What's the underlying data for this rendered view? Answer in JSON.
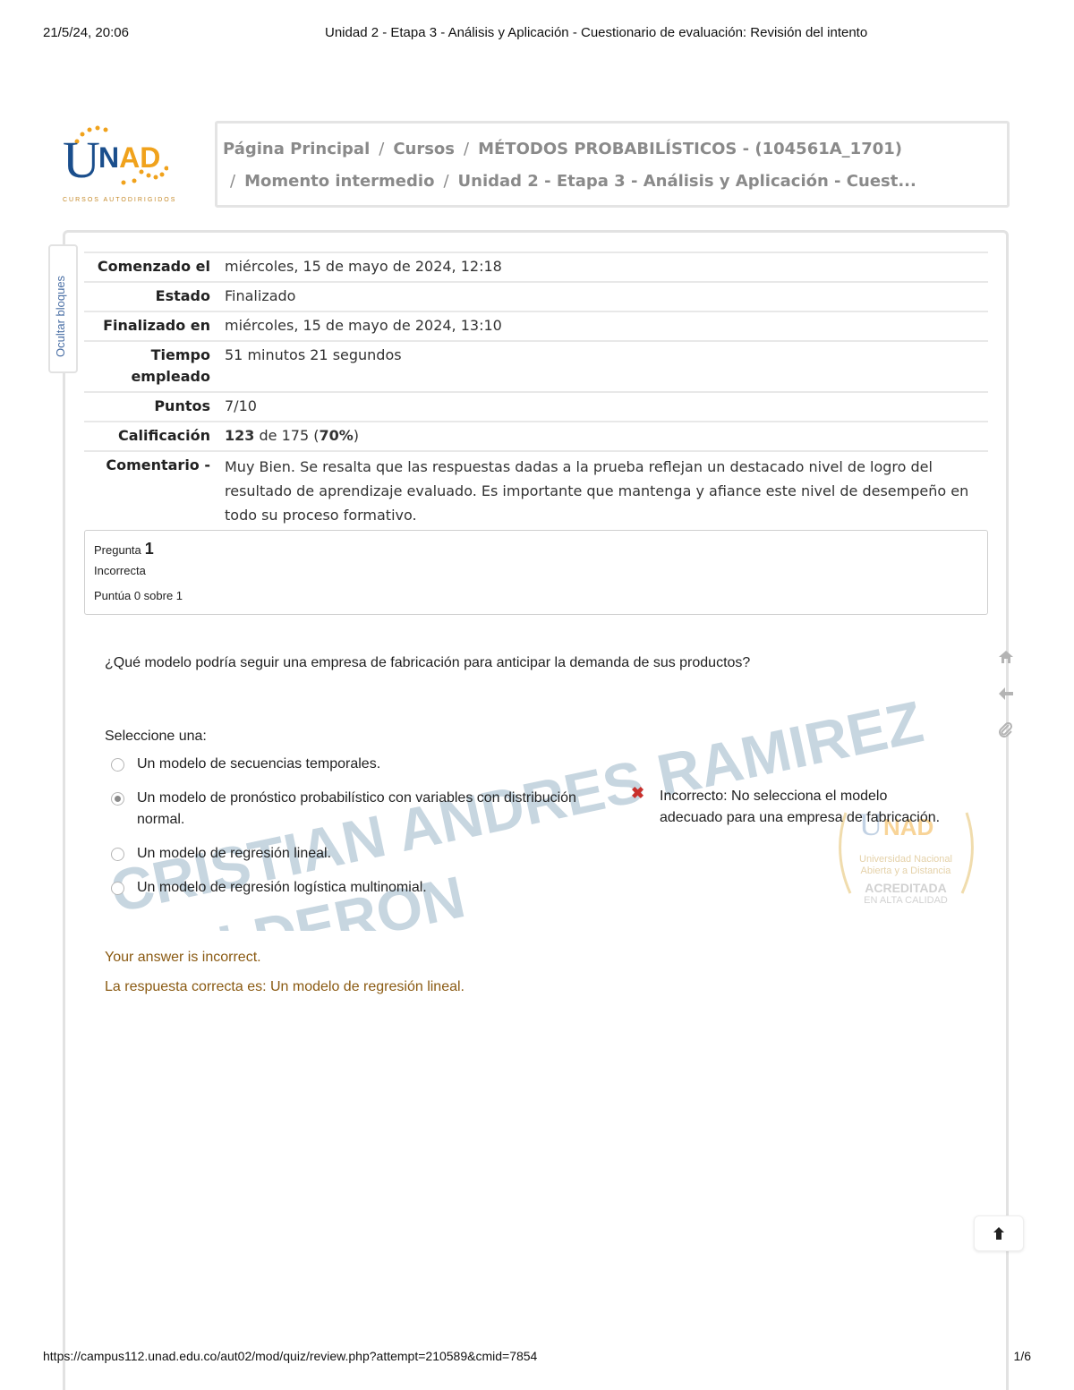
{
  "print_header": {
    "timestamp": "21/5/24, 20:06",
    "title": "Unidad 2 - Etapa 3 - Análisis y Aplicación - Cuestionario de evaluación: Revisión del intento"
  },
  "print_footer": {
    "url": "https://campus112.unad.edu.co/aut02/mod/quiz/review.php?attempt=210589&cmid=7854",
    "page": "1/6"
  },
  "logo": {
    "u": "U",
    "n": "N",
    "ad": "AD",
    "subtitle": "CURSOS AUTODIRIGIDOS"
  },
  "breadcrumb": {
    "items": [
      "Página Principal",
      "Cursos",
      "MÉTODOS PROBABILÍSTICOS - (104561A_1701)",
      "Momento intermedio",
      "Unidad 2 - Etapa 3 - Análisis y Aplicación - Cuest..."
    ],
    "separator": "/"
  },
  "hide_blocks_label": "Ocultar bloques",
  "summary": {
    "started_label": "Comenzado el",
    "started_value": "miércoles, 15 de mayo de 2024, 12:18",
    "state_label": "Estado",
    "state_value": "Finalizado",
    "finished_label": "Finalizado en",
    "finished_value": "miércoles, 15 de mayo de 2024, 13:10",
    "time_label_1": "Tiempo",
    "time_label_2": "empleado",
    "time_value": "51 minutos 21 segundos",
    "points_label": "Puntos",
    "points_value": "7/10",
    "grade_label": "Calificación",
    "grade_score": "123",
    "grade_mid": " de 175 (",
    "grade_percent": "70%",
    "grade_end": ")",
    "comment_label": "Comentario -",
    "comment_value": "Muy Bien. Se resalta que las respuestas dadas a la prueba reflejan un destacado nivel de logro del resultado de aprendizaje evaluado.   Es importante que mantenga y afiance este nivel de desempeño en todo su proceso formativo."
  },
  "question": {
    "label": "Pregunta",
    "number": "1",
    "state": "Incorrecta",
    "grade": "Puntúa 0 sobre 1",
    "text": "¿Qué modelo podría seguir una empresa de fabricación para anticipar la demanda de sus productos?",
    "prompt": "Seleccione una:",
    "options": [
      {
        "text": "Un modelo de secuencias temporales.",
        "selected": false
      },
      {
        "text": "Un modelo de pronóstico probabilístico con variables con distribución normal.",
        "selected": true
      },
      {
        "text": "Un modelo de regresión lineal.",
        "selected": false
      },
      {
        "text": "Un modelo de regresión logística multinomial.",
        "selected": false
      }
    ],
    "feedback": "Incorrecto: No selecciona el modelo adecuado para una empresa de fabricación.",
    "outcome": "Your answer is incorrect.",
    "right_answer": "La respuesta correcta es: Un modelo de regresión lineal."
  },
  "watermark": {
    "line1": "CRISTIAN ANDRES RAMIREZ",
    "line2": "CALDERON"
  },
  "seal": {
    "line1": "Universidad Nacional",
    "line2": "Abierta y a Distancia",
    "line3": "ACREDITADA",
    "line4": "EN ALTA CALIDAD"
  },
  "colors": {
    "unad_blue": "#1a4e8c",
    "unad_orange": "#f0a21c",
    "outcome_brown": "#8a5a12",
    "incorrect_red": "#c9302c",
    "watermark": "#c7d6e0"
  },
  "icons": [
    "home-icon",
    "arrow-left-icon",
    "paperclip-icon",
    "arrow-up-icon",
    "x-mark-icon"
  ]
}
